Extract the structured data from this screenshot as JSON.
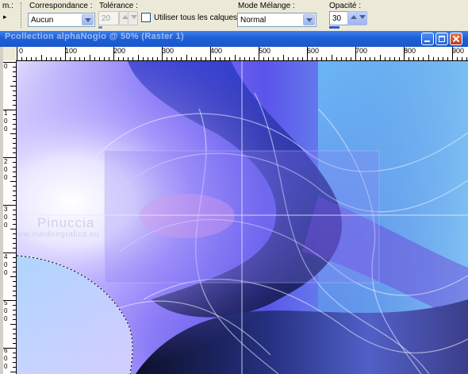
{
  "toolbar": {
    "left_fragment": "m.:",
    "correspondance": {
      "label": "Correspondance :",
      "value": "Aucun"
    },
    "tolerance": {
      "label": "Tolérance :",
      "value": "20"
    },
    "all_layers": {
      "label": "Utiliser tous les calques",
      "checked": false
    },
    "blend_mode": {
      "label": "Mode Mélange :",
      "value": "Normal"
    },
    "opacity": {
      "label": "Opacité :",
      "value": "30"
    }
  },
  "window": {
    "title": "Pcollection alphaNogio @ 50% (Raster 1)",
    "controls": [
      "minimize",
      "maximize",
      "close"
    ]
  },
  "rulers": {
    "horizontal": [
      "0",
      "100",
      "200",
      "300",
      "400",
      "500",
      "600",
      "700",
      "800",
      "900"
    ],
    "vertical": [
      "0",
      "100",
      "200",
      "300",
      "400",
      "500",
      "600"
    ]
  },
  "watermark": {
    "name": "Pinuccia",
    "site": "www.maidiregrafica.eu"
  },
  "colors": {
    "accent": "#1d5fd6",
    "canvas_blue": "#4b4fe0",
    "canvas_dark": "#101a40"
  }
}
